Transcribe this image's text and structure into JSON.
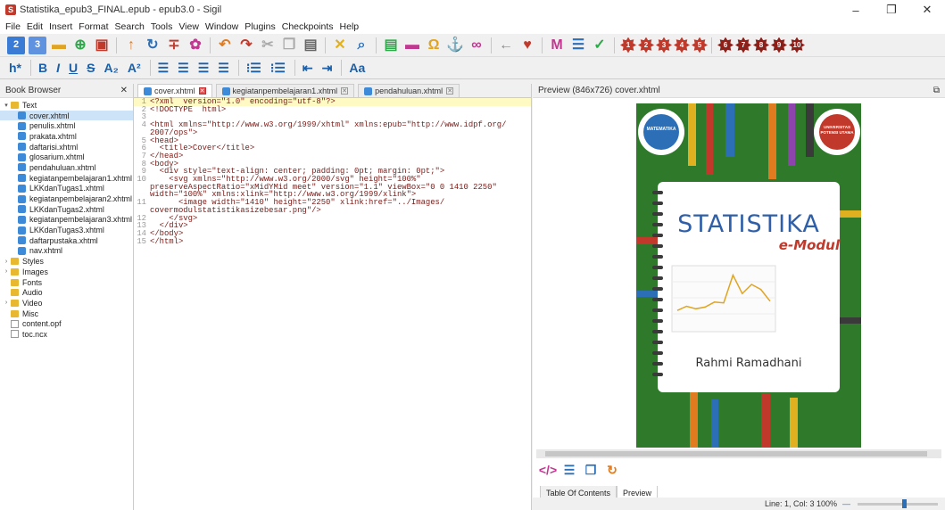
{
  "window": {
    "title": "Statistika_epub3_FINAL.epub - epub3.0 - Sigil",
    "app_icon": "sigil-app-icon"
  },
  "menu": [
    "File",
    "Edit",
    "Insert",
    "Format",
    "Search",
    "Tools",
    "View",
    "Window",
    "Plugins",
    "Checkpoints",
    "Help"
  ],
  "toolbar2": {
    "heading": "h*",
    "bold": "B",
    "italic": "I",
    "underline": "U",
    "strike": "S",
    "subscript": "A₂",
    "superscript": "A²",
    "text_case": "Aa"
  },
  "book_browser": {
    "title": "Book Browser",
    "items": [
      {
        "label": "Text",
        "type": "folder",
        "expanded": true,
        "indent": 0
      },
      {
        "label": "cover.xhtml",
        "type": "file",
        "indent": 1,
        "selected": true
      },
      {
        "label": "penulis.xhtml",
        "type": "file",
        "indent": 1
      },
      {
        "label": "prakata.xhtml",
        "type": "file",
        "indent": 1
      },
      {
        "label": "daftarisi.xhtml",
        "type": "file",
        "indent": 1
      },
      {
        "label": "glosarium.xhtml",
        "type": "file",
        "indent": 1
      },
      {
        "label": "pendahuluan.xhtml",
        "type": "file",
        "indent": 1
      },
      {
        "label": "kegiatanpembelajaran1.xhtml",
        "type": "file",
        "indent": 1
      },
      {
        "label": "LKKdanTugas1.xhtml",
        "type": "file",
        "indent": 1
      },
      {
        "label": "kegiatanpembelajaran2.xhtml",
        "type": "file",
        "indent": 1
      },
      {
        "label": "LKKdanTugas2.xhtml",
        "type": "file",
        "indent": 1
      },
      {
        "label": "kegiatanpembelajaran3.xhtml",
        "type": "file",
        "indent": 1
      },
      {
        "label": "LKKdanTugas3.xhtml",
        "type": "file",
        "indent": 1
      },
      {
        "label": "daftarpustaka.xhtml",
        "type": "file",
        "indent": 1
      },
      {
        "label": "nav.xhtml",
        "type": "file",
        "indent": 1
      },
      {
        "label": "Styles",
        "type": "folder",
        "indent": 0
      },
      {
        "label": "Images",
        "type": "folder",
        "indent": 0
      },
      {
        "label": "Fonts",
        "type": "folder",
        "indent": 0
      },
      {
        "label": "Audio",
        "type": "folder",
        "indent": 0
      },
      {
        "label": "Video",
        "type": "folder",
        "indent": 0
      },
      {
        "label": "Misc",
        "type": "folder",
        "indent": 0
      },
      {
        "label": "content.opf",
        "type": "plainfile",
        "indent": 0
      },
      {
        "label": "toc.ncx",
        "type": "plainfile",
        "indent": 0
      }
    ]
  },
  "editor": {
    "tabs": [
      {
        "label": "cover.xhtml",
        "active": true
      },
      {
        "label": "kegiatanpembelajaran1.xhtml",
        "active": false
      },
      {
        "label": "pendahuluan.xhtml",
        "active": false
      }
    ],
    "lines": [
      {
        "n": "1",
        "text": "<?xml  version=\"1.0\" encoding=\"utf-8\"?>"
      },
      {
        "n": "2",
        "text": "<!DOCTYPE  html>"
      },
      {
        "n": "3",
        "text": ""
      },
      {
        "n": "4",
        "text": "<html xmlns=\"http://www.w3.org/1999/xhtml\" xmlns:epub=\"http://www.idpf.org/"
      },
      {
        "n": "",
        "text": "2007/ops\">"
      },
      {
        "n": "5",
        "text": "<head>"
      },
      {
        "n": "6",
        "text": "  <title>Cover</title>"
      },
      {
        "n": "7",
        "text": "</head>"
      },
      {
        "n": "8",
        "text": "<body>"
      },
      {
        "n": "9",
        "text": "  <div style=\"text-align: center; padding: 0pt; margin: 0pt;\">"
      },
      {
        "n": "10",
        "text": "    <svg xmlns=\"http://www.w3.org/2000/svg\" height=\"100%\""
      },
      {
        "n": "",
        "text": "preserveAspectRatio=\"xMidYMid meet\" version=\"1.1\" viewBox=\"0 0 1410 2250\""
      },
      {
        "n": "",
        "text": "width=\"100%\" xmlns:xlink=\"http://www.w3.org/1999/xlink\">"
      },
      {
        "n": "11",
        "text": "      <image width=\"1410\" height=\"2250\" xlink:href=\"../Images/"
      },
      {
        "n": "",
        "text": "covermodulstatistikasizebesar.png\"/>"
      },
      {
        "n": "12",
        "text": "    </svg>"
      },
      {
        "n": "13",
        "text": "  </div>"
      },
      {
        "n": "14",
        "text": "</body>"
      },
      {
        "n": "15",
        "text": "</html>"
      }
    ]
  },
  "preview": {
    "title": "Preview (846x726) cover.xhtml",
    "cover": {
      "title": "STATISTIKA",
      "subtitle": "e-Modul",
      "author": "Rahmi Ramadhani",
      "badge_left": "MATEMATIKA",
      "badge_right": "UNIVERSITAS POTENSI UTAMA",
      "chart_series": [
        2.1,
        2.6,
        2.3,
        2.5,
        3.1,
        3.0,
        6.3,
        4.1,
        5.2,
        4.6,
        3.2
      ]
    },
    "tabs": [
      "Table Of Contents",
      "Preview"
    ]
  },
  "status": {
    "text": "Line: 1, Col: 3 100%"
  },
  "colors": {
    "accent_blue": "#2d6fb7",
    "hexagon_red": "#c0392b",
    "cover_green": "#2f7a2a",
    "cover_title": "#2e5fa8",
    "cover_subtitle": "#c0392b"
  }
}
